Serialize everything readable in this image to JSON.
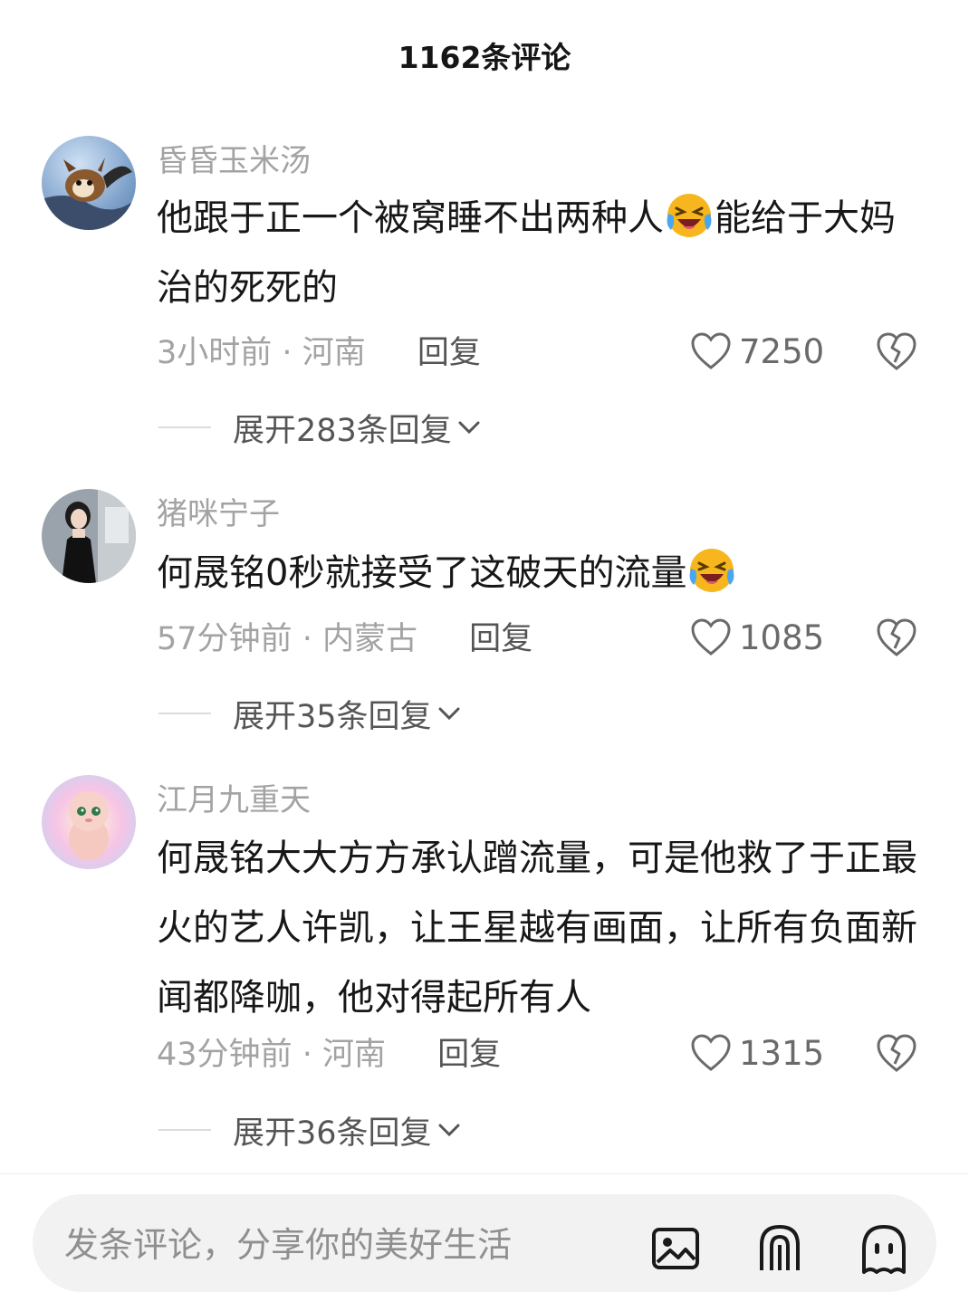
{
  "header": {
    "title": "1162条评论"
  },
  "comments": [
    {
      "username": "昏昏玉米汤",
      "text_parts": [
        "他跟于正一个被窝睡不出两种人",
        "能给于大妈治的死死的"
      ],
      "emoji": "laughing-crying-emoji",
      "time": "3小时前",
      "location": "河南",
      "separator": "·",
      "reply_label": "回复",
      "likes": "7250",
      "expand_label": "展开283条回复"
    },
    {
      "username": "猪咪宁子",
      "text_parts": [
        "何晟铭0秒就接受了这破天的流量",
        ""
      ],
      "emoji": "laughing-crying-emoji",
      "time": "57分钟前",
      "location": "内蒙古",
      "separator": "·",
      "reply_label": "回复",
      "likes": "1085",
      "expand_label": "展开35条回复"
    },
    {
      "username": "江月九重天",
      "text_parts": [
        "何晟铭大大方方承认蹭流量，可是他救了于正最火的艺人许凯，让王星越有画面，让所有负面新闻都降咖，他对得起所有人"
      ],
      "time": "43分钟前",
      "location": "河南",
      "separator": "·",
      "reply_label": "回复",
      "likes": "1315",
      "expand_label": "展开36条回复"
    }
  ],
  "bottom_bar": {
    "placeholder": "发条评论，分享你的美好生活",
    "icons": [
      "image-icon",
      "at-mention-icon",
      "emoji-ghost-icon"
    ]
  },
  "colors": {
    "meta_gray": "#a3a3a3",
    "emoji_yellow": "#f7b61d",
    "input_bg": "#f2f2f2"
  }
}
